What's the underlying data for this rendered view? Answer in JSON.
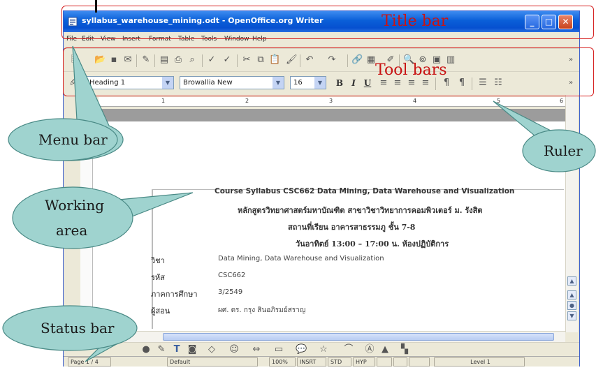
{
  "window": {
    "title": "syllabus_warehouse_mining.odt - OpenOffice.org Writer",
    "controls": {
      "minimize": "_",
      "maximize": "□",
      "close": "✕"
    }
  },
  "menu": [
    "File",
    "Edit",
    "View",
    "Insert",
    "Format",
    "Table",
    "Tools",
    "Window",
    "Help"
  ],
  "format_bar": {
    "paragraph_style": "Heading 1",
    "font_name": "Browallia New",
    "font_size": "16",
    "bold": "B",
    "italic": "I",
    "underline": "U"
  },
  "ruler": {
    "numbers": [
      "1",
      "2",
      "3",
      "4",
      "5",
      "6"
    ]
  },
  "document": {
    "title_line": "Course Syllabus CSC662 Data Mining, Data Warehouse and Visualization",
    "thai_line1": "หลักสูตรวิทยาศาสตร์มหาบัณฑิต สาขาวิชาวิทยาการคอมพิวเตอร์ ม. รังสิต",
    "thai_line2": "สถานที่เรียน อาคารสาธรรมภู ชั้น 7-8",
    "thai_line3": "วันอาทิตย์ 13:00 – 17:00 น. ห้องปฏิบัติการ",
    "fields": [
      {
        "label": "วิชา",
        "value": "Data Mining, Data Warehouse and Visualization"
      },
      {
        "label": "รหัส",
        "value": "CSC662"
      },
      {
        "label": "ภาคการศึกษา",
        "value": "3/2549"
      },
      {
        "label": "ผู้สอน",
        "value": "ผศ. ดร. กรุง สินอภิรมย์สราญ"
      }
    ]
  },
  "status": {
    "page": "Page 1 / 4",
    "style": "Default",
    "zoom": "100%",
    "insert_mode": "INSRT",
    "selection_mode": "STD",
    "hyperlink_mode": "HYP",
    "outline_level": "Level 1"
  },
  "annotations": {
    "title_bar": "Title bar",
    "tool_bars": "Tool bars",
    "menu_bar": "Menu bar",
    "ruler": "Ruler",
    "working_area_1": "Working",
    "working_area_2": "area",
    "status_bar": "Status bar"
  },
  "colors": {
    "callout_red": "#c81414",
    "bubble_fill": "#9fd3cf",
    "titlebar_blue": "#0a5fd8"
  }
}
